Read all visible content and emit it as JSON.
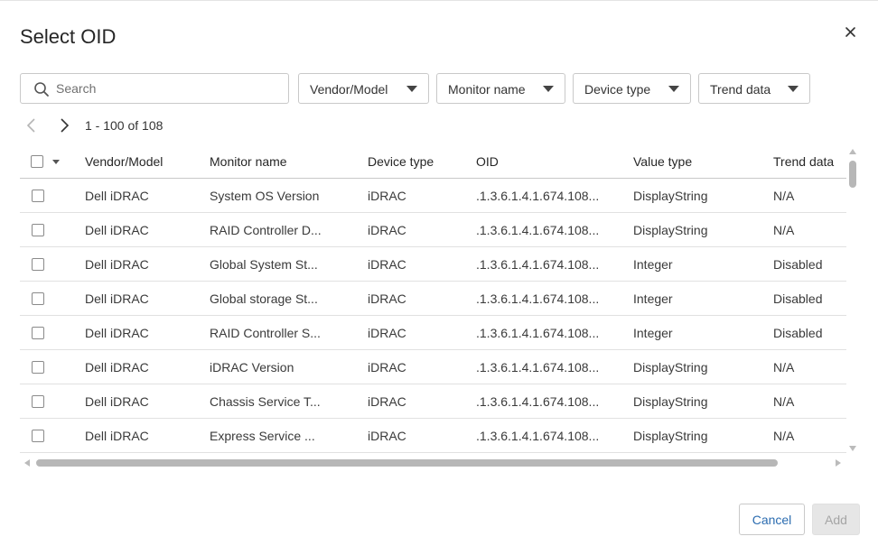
{
  "dialog": {
    "title": "Select OID"
  },
  "search": {
    "placeholder": "Search",
    "value": ""
  },
  "filters": [
    {
      "label": "Vendor/Model"
    },
    {
      "label": "Monitor name"
    },
    {
      "label": "Device type"
    },
    {
      "label": "Trend data"
    }
  ],
  "pager": {
    "range": "1 - 100 of 108"
  },
  "table": {
    "columns": [
      "Vendor/Model",
      "Monitor name",
      "Device type",
      "OID",
      "Value type",
      "Trend data"
    ],
    "rows": [
      {
        "vendor": "Dell iDRAC",
        "monitor": "System OS Version",
        "device": "iDRAC",
        "oid": ".1.3.6.1.4.1.674.108...",
        "value": "DisplayString",
        "trend": "N/A"
      },
      {
        "vendor": "Dell iDRAC",
        "monitor": "RAID Controller D...",
        "device": "iDRAC",
        "oid": ".1.3.6.1.4.1.674.108...",
        "value": "DisplayString",
        "trend": "N/A"
      },
      {
        "vendor": "Dell iDRAC",
        "monitor": "Global System St...",
        "device": "iDRAC",
        "oid": ".1.3.6.1.4.1.674.108...",
        "value": "Integer",
        "trend": "Disabled"
      },
      {
        "vendor": "Dell iDRAC",
        "monitor": "Global storage St...",
        "device": "iDRAC",
        "oid": ".1.3.6.1.4.1.674.108...",
        "value": "Integer",
        "trend": "Disabled"
      },
      {
        "vendor": "Dell iDRAC",
        "monitor": "RAID Controller S...",
        "device": "iDRAC",
        "oid": ".1.3.6.1.4.1.674.108...",
        "value": "Integer",
        "trend": "Disabled"
      },
      {
        "vendor": "Dell iDRAC",
        "monitor": "iDRAC Version",
        "device": "iDRAC",
        "oid": ".1.3.6.1.4.1.674.108...",
        "value": "DisplayString",
        "trend": "N/A"
      },
      {
        "vendor": "Dell iDRAC",
        "monitor": "Chassis Service T...",
        "device": "iDRAC",
        "oid": ".1.3.6.1.4.1.674.108...",
        "value": "DisplayString",
        "trend": "N/A"
      },
      {
        "vendor": "Dell iDRAC",
        "monitor": "Express Service ...",
        "device": "iDRAC",
        "oid": ".1.3.6.1.4.1.674.108...",
        "value": "DisplayString",
        "trend": "N/A"
      }
    ]
  },
  "actions": {
    "cancel_label": "Cancel",
    "add_label": "Add"
  },
  "colors": {
    "link_blue": "#2b6cb0",
    "disabled_bg": "#e6e6e6",
    "border": "#c9c9c9"
  },
  "icons": {
    "close": "close-icon",
    "search": "search-icon",
    "prev": "chevron-left-icon",
    "next": "chevron-right-icon"
  }
}
